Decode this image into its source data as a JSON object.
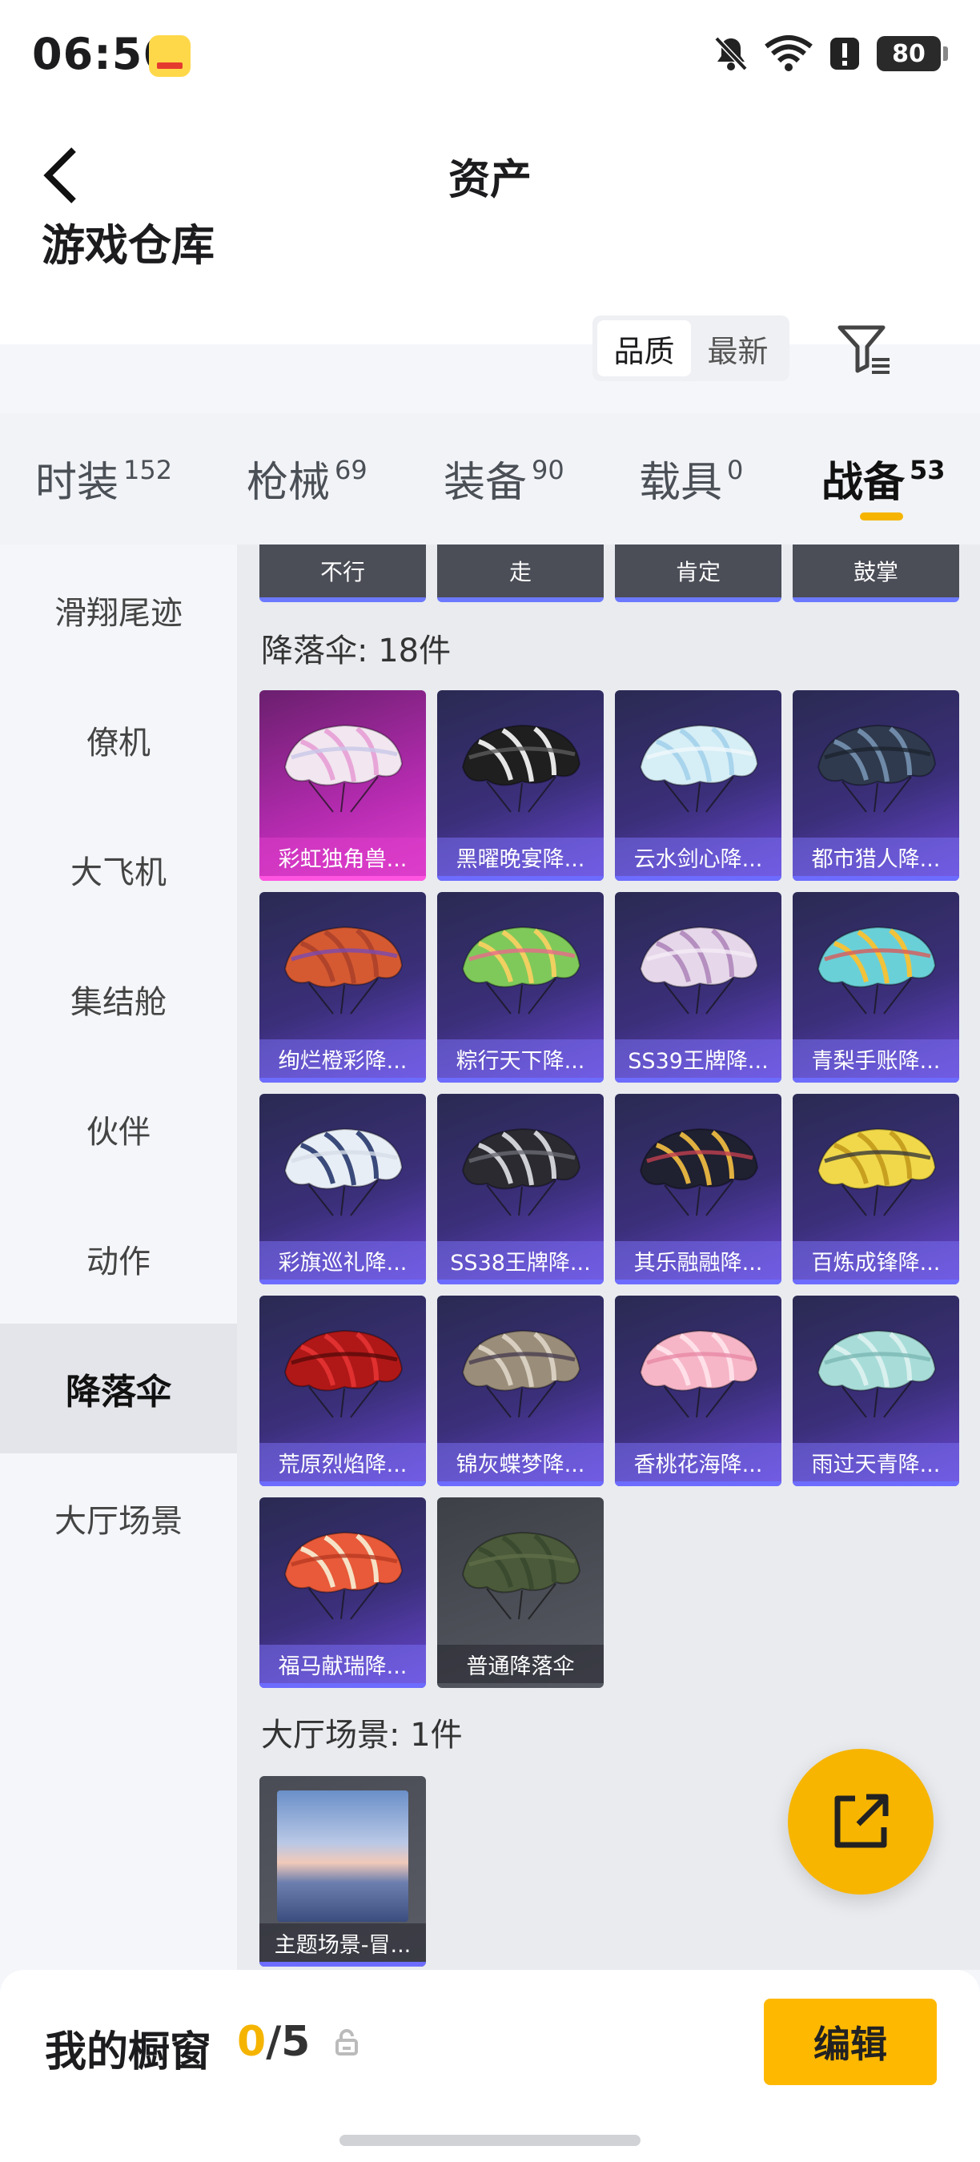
{
  "status_bar": {
    "time": "06:56",
    "battery": "80"
  },
  "header": {
    "title": "资产",
    "warehouse_title": "游戏仓库",
    "sort_options": [
      "品质",
      "最新"
    ]
  },
  "category_tabs": [
    {
      "label": "时装",
      "count": "152"
    },
    {
      "label": "枪械",
      "count": "69"
    },
    {
      "label": "装备",
      "count": "90"
    },
    {
      "label": "载具",
      "count": "0"
    },
    {
      "label": "战备",
      "count": "53",
      "active": true
    }
  ],
  "sidebar": {
    "items": [
      "滑翔尾迹",
      "僚机",
      "大飞机",
      "集结舱",
      "伙伴",
      "动作",
      "降落伞",
      "大厅场景"
    ],
    "active_index": 6
  },
  "emotes": [
    "不行",
    "走",
    "肯定",
    "鼓掌"
  ],
  "parachute_section": {
    "title": "降落伞: 18件",
    "items": [
      {
        "name": "彩虹独角兽...",
        "colors": [
          "#f2e6f0",
          "#e8a6d8",
          "#c8c8e8"
        ]
      },
      {
        "name": "黑曜晚宴降...",
        "colors": [
          "#1f1f1f",
          "#e6e6e6",
          "#5a5a5a"
        ]
      },
      {
        "name": "云水剑心降...",
        "colors": [
          "#d6eef6",
          "#a8d4ec",
          "#f0f8fb"
        ]
      },
      {
        "name": "都市猎人降...",
        "colors": [
          "#2f3a4e",
          "#6f8aa8",
          "#1d2430"
        ]
      },
      {
        "name": "绚烂橙彩降...",
        "colors": [
          "#d55a32",
          "#b0432a",
          "#7a4ab0"
        ]
      },
      {
        "name": "粽行天下降...",
        "colors": [
          "#7fc95a",
          "#f0d060",
          "#e86a8a"
        ]
      },
      {
        "name": "SS39王牌降...",
        "colors": [
          "#e6d8ea",
          "#b58fc0",
          "#f5ecf6"
        ]
      },
      {
        "name": "青梨手账降...",
        "colors": [
          "#6ad0d8",
          "#f2c23a",
          "#d85a5a"
        ]
      },
      {
        "name": "彩旗巡礼降...",
        "colors": [
          "#e8eef6",
          "#3a4a7a",
          "#d6dde8"
        ]
      },
      {
        "name": "SS38王牌降...",
        "colors": [
          "#2a2a30",
          "#cfcfd6",
          "#6a6a74"
        ]
      },
      {
        "name": "其乐融融降...",
        "colors": [
          "#1f2030",
          "#e0b040",
          "#c04050"
        ]
      },
      {
        "name": "百炼成锋降...",
        "colors": [
          "#f0d84a",
          "#c8a020",
          "#3a3a3a"
        ]
      },
      {
        "name": "荒原烈焰降...",
        "colors": [
          "#b01818",
          "#e03030",
          "#5a0a0a"
        ]
      },
      {
        "name": "锦灰蝶梦降...",
        "colors": [
          "#9a8d7a",
          "#d8cfc0",
          "#4a4050"
        ]
      },
      {
        "name": "香桃花海降...",
        "colors": [
          "#f6b6c8",
          "#ffe0e8",
          "#e88aa6"
        ]
      },
      {
        "name": "雨过天青降...",
        "colors": [
          "#a8dcd8",
          "#d8f0ee",
          "#7ab8b4"
        ]
      },
      {
        "name": "福马献瑞降...",
        "colors": [
          "#e85a3a",
          "#f6e2c6",
          "#b83a22"
        ]
      },
      {
        "name": "普通降落伞",
        "colors": [
          "#4a5a3a",
          "#3a4a2e",
          "#5f6e48"
        ],
        "grey": true
      }
    ]
  },
  "scene_section": {
    "title": "大厅场景: 1件",
    "items": [
      {
        "name": "主题场景-冒..."
      }
    ]
  },
  "bottom_bar": {
    "title": "我的橱窗",
    "current": "0",
    "total": "/5",
    "edit_label": "编辑"
  }
}
